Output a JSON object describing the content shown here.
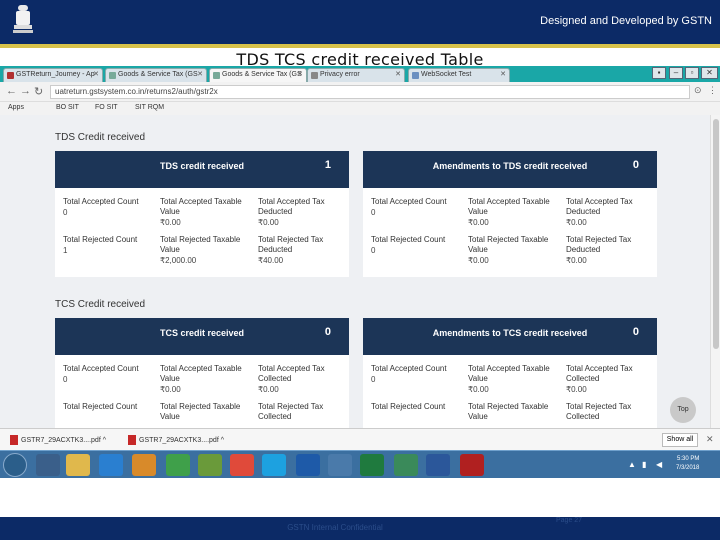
{
  "banner": {
    "credit": "Designed and Developed by GSTN"
  },
  "slide_title": "TDS TCS credit received Table",
  "browser": {
    "tabs": [
      {
        "label": "GSTReturn_Journey - Ap"
      },
      {
        "label": "Goods & Service Tax (GS"
      },
      {
        "label": "Goods & Service Tax (GS"
      },
      {
        "label": "Privacy error"
      },
      {
        "label": "WebSocket Test"
      }
    ],
    "url": "uatreturn.gstsystem.co.in/returns2/auth/gstr2x",
    "bookmarks": [
      "Apps",
      "BO SIT",
      "FO SIT",
      "SIT RQM"
    ]
  },
  "tds": {
    "section_title": "TDS Credit received",
    "received_card": {
      "title": "TDS credit received",
      "count": "1",
      "fields": [
        {
          "label": "Total Accepted Count",
          "value": "0"
        },
        {
          "label": "Total Accepted Taxable Value",
          "value": "₹0.00"
        },
        {
          "label": "Total Accepted Tax Deducted",
          "value": "₹0.00"
        },
        {
          "label": "Total Rejected Count",
          "value": "1"
        },
        {
          "label": "Total Rejected Taxable Value",
          "value": "₹2,000.00"
        },
        {
          "label": "Total Rejected Tax Deducted",
          "value": "₹40.00"
        }
      ]
    },
    "amend_card": {
      "title": "Amendments to TDS credit received",
      "count": "0",
      "fields": [
        {
          "label": "Total Accepted Count",
          "value": "0"
        },
        {
          "label": "Total Accepted Taxable Value",
          "value": "₹0.00"
        },
        {
          "label": "Total Accepted Tax Deducted",
          "value": "₹0.00"
        },
        {
          "label": "Total Rejected Count",
          "value": "0"
        },
        {
          "label": "Total Rejected Taxable Value",
          "value": "₹0.00"
        },
        {
          "label": "Total Rejected Tax Deducted",
          "value": "₹0.00"
        }
      ]
    }
  },
  "tcs": {
    "section_title": "TCS Credit received",
    "received_card": {
      "title": "TCS credit received",
      "count": "0",
      "fields": [
        {
          "label": "Total Accepted Count",
          "value": "0"
        },
        {
          "label": "Total Accepted Taxable Value",
          "value": "₹0.00"
        },
        {
          "label": "Total Accepted Tax Collected",
          "value": "₹0.00"
        },
        {
          "label": "Total Rejected Count",
          "value": ""
        },
        {
          "label": "Total Rejected Taxable Value",
          "value": ""
        },
        {
          "label": "Total Rejected Tax Collected",
          "value": ""
        }
      ]
    },
    "amend_card": {
      "title": "Amendments to TCS credit received",
      "count": "0",
      "fields": [
        {
          "label": "Total Accepted Count",
          "value": "0"
        },
        {
          "label": "Total Accepted Taxable Value",
          "value": "₹0.00"
        },
        {
          "label": "Total Accepted Tax Collected",
          "value": "₹0.00"
        },
        {
          "label": "Total Rejected Count",
          "value": ""
        },
        {
          "label": "Total Rejected Taxable Value",
          "value": ""
        },
        {
          "label": "Total Rejected Tax Collected",
          "value": ""
        }
      ]
    }
  },
  "top_button": "Top",
  "downloads": {
    "items": [
      "GSTR7_29ACXTK3....pdf",
      "GSTR7_29ACXTK3....pdf"
    ],
    "show_all": "Show all"
  },
  "taskbar": {
    "time": "5:30 PM",
    "date": "7/3/2018"
  },
  "footer": {
    "confidential": "GSTN Internal Confidential",
    "page": "Page 27"
  },
  "colors": {
    "banner": "#0c2a66",
    "card_header": "#1c3557",
    "tabstrip": "#1aa7a7",
    "taskbar": "#3b6fa0"
  }
}
